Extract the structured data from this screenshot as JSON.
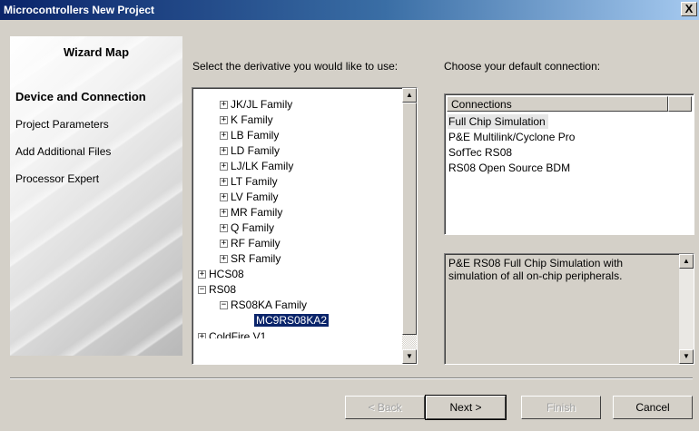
{
  "window": {
    "title": "Microcontrollers New Project",
    "close": "X"
  },
  "wizard_map": {
    "heading": "Wizard Map",
    "items": [
      {
        "label": "Device and Connection",
        "active": true
      },
      {
        "label": "Project Parameters",
        "active": false
      },
      {
        "label": "Add Additional Files",
        "active": false
      },
      {
        "label": "Processor Expert",
        "active": false
      }
    ]
  },
  "derivative": {
    "label": "Select the derivative you would like to use:",
    "tree": [
      {
        "label": "JK/JL Family",
        "expander": "+"
      },
      {
        "label": "K Family",
        "expander": "+"
      },
      {
        "label": "LB Family",
        "expander": "+"
      },
      {
        "label": "LD Family",
        "expander": "+"
      },
      {
        "label": "LJ/LK Family",
        "expander": "+"
      },
      {
        "label": "LT Family",
        "expander": "+"
      },
      {
        "label": "LV Family",
        "expander": "+"
      },
      {
        "label": "MR Family",
        "expander": "+"
      },
      {
        "label": "Q Family",
        "expander": "+"
      },
      {
        "label": "RF Family",
        "expander": "+"
      },
      {
        "label": "SR Family",
        "expander": "+"
      },
      {
        "label": "HCS08",
        "expander": "+"
      },
      {
        "label": "RS08",
        "expander": "−"
      },
      {
        "label": "RS08KA Family",
        "expander": "−"
      },
      {
        "label": "MC9RS08KA2",
        "expander": "",
        "selected": true
      },
      {
        "label": "ColdFire V1",
        "expander": "+"
      }
    ]
  },
  "connection": {
    "label": "Choose your default connection:",
    "header": "Connections",
    "items": [
      {
        "label": "Full Chip Simulation",
        "selected": true
      },
      {
        "label": "P&E Multilink/Cyclone Pro"
      },
      {
        "label": "SofTec RS08"
      },
      {
        "label": "RS08 Open Source BDM"
      }
    ],
    "description": "P&E RS08 Full Chip Simulation with simulation of all on-chip peripherals."
  },
  "buttons": {
    "back": "< Back",
    "next": "Next >",
    "finish": "Finish",
    "cancel": "Cancel"
  }
}
